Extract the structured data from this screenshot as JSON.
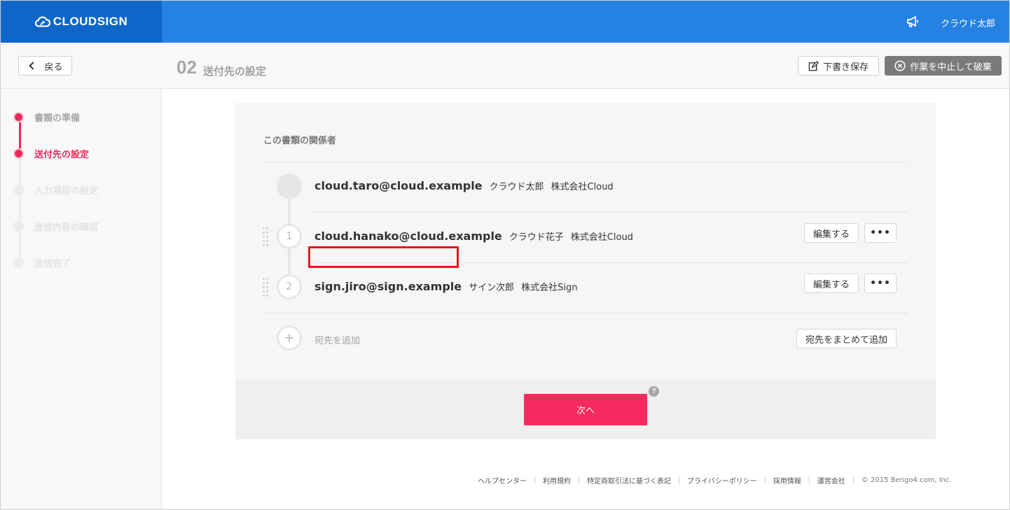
{
  "app": {
    "logo_text": "CLOUDSIGN",
    "user_name": "クラウド太郎",
    "accent_color": "#f52a5e",
    "nav_color": "#2682e2"
  },
  "header": {
    "back_label": "戻る",
    "step_number": "02",
    "step_title": "送付先の設定",
    "draft_label": "下書き保存",
    "abort_label": "作業を中止して破棄"
  },
  "sidebar": {
    "steps": [
      {
        "label": "書類の準備",
        "state": "done"
      },
      {
        "label": "送付先の設定",
        "state": "current"
      },
      {
        "label": "入力項目の設定",
        "state": "todo"
      },
      {
        "label": "送信内容の確認",
        "state": "todo"
      },
      {
        "label": "送信完了",
        "state": "todo"
      }
    ]
  },
  "card": {
    "title": "この書類の関係者",
    "owner": {
      "email": "cloud.taro@cloud.example",
      "name": "クラウド太郎",
      "company": "株式会社Cloud"
    },
    "recipients": [
      {
        "order": "1",
        "email": "cloud.hanako@cloud.example",
        "name": "クラウド花子",
        "company": "株式会社Cloud",
        "edit_label": "編集する",
        "more_label": "•••"
      },
      {
        "order": "2",
        "email": "sign.jiro@sign.example",
        "name": "サイン次郎",
        "company": "株式会社Sign",
        "edit_label": "編集する",
        "more_label": "•••"
      }
    ],
    "add_label": "宛先を追加",
    "bulk_add_label": "宛先をまとめて追加"
  },
  "action": {
    "next_label": "次へ",
    "help_label": "?"
  },
  "footer": {
    "links": [
      "ヘルプセンター",
      "利用規約",
      "特定商取引法に基づく表記",
      "プライバシーポリシー",
      "採用情報",
      "運営会社"
    ],
    "copyright": "© 2015 Bengo4.com, Inc."
  }
}
